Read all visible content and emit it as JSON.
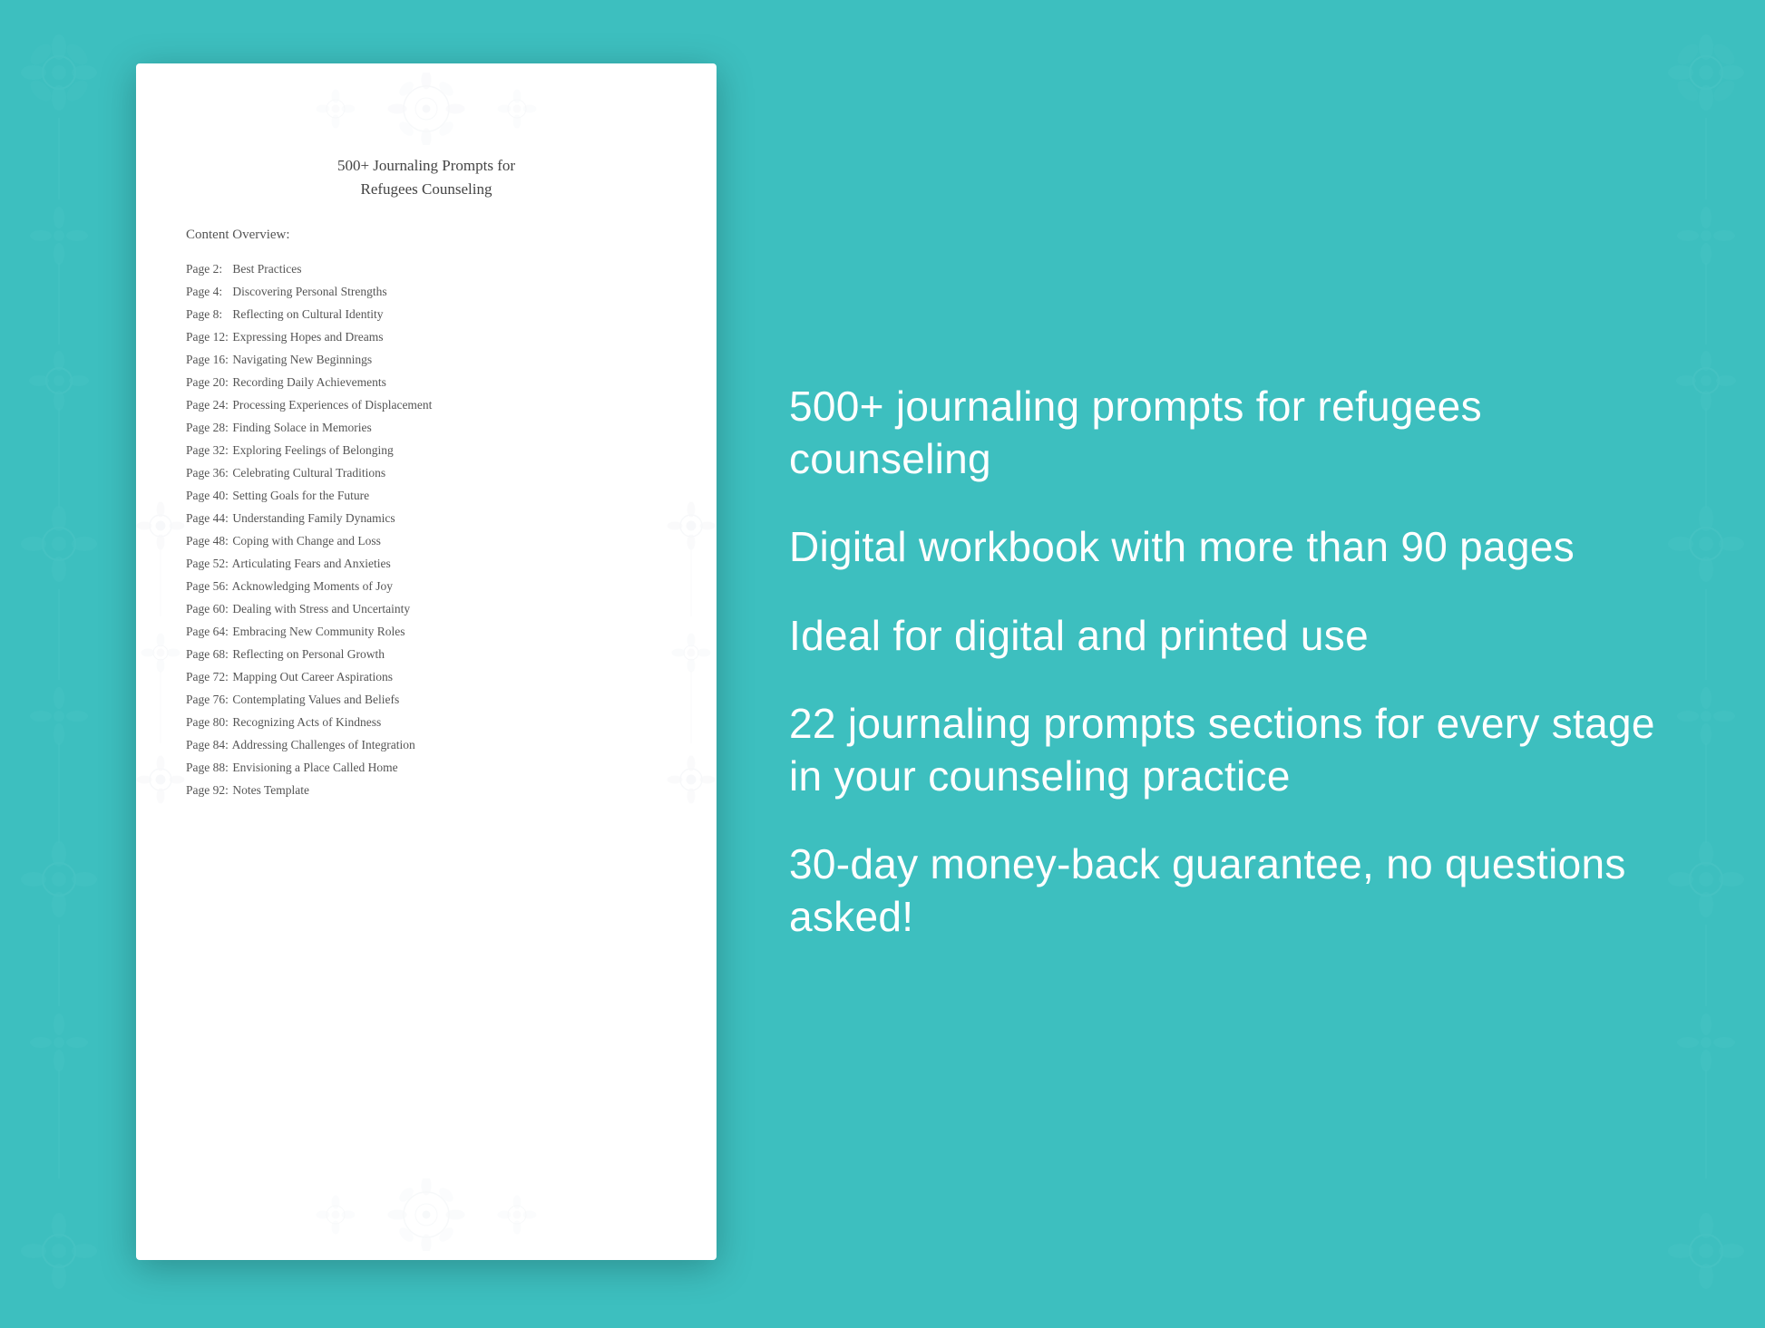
{
  "background_color": "#3dbfbf",
  "document": {
    "title_line1": "500+ Journaling Prompts for",
    "title_line2": "Refugees Counseling",
    "section_label": "Content Overview:",
    "toc_items": [
      {
        "page": "Page  2:",
        "title": "Best Practices"
      },
      {
        "page": "Page  4:",
        "title": "Discovering Personal Strengths"
      },
      {
        "page": "Page  8:",
        "title": "Reflecting on Cultural Identity"
      },
      {
        "page": "Page 12:",
        "title": "Expressing Hopes and Dreams"
      },
      {
        "page": "Page 16:",
        "title": "Navigating New Beginnings"
      },
      {
        "page": "Page 20:",
        "title": "Recording Daily Achievements"
      },
      {
        "page": "Page 24:",
        "title": "Processing Experiences of Displacement"
      },
      {
        "page": "Page 28:",
        "title": "Finding Solace in Memories"
      },
      {
        "page": "Page 32:",
        "title": "Exploring Feelings of Belonging"
      },
      {
        "page": "Page 36:",
        "title": "Celebrating Cultural Traditions"
      },
      {
        "page": "Page 40:",
        "title": "Setting Goals for the Future"
      },
      {
        "page": "Page 44:",
        "title": "Understanding Family Dynamics"
      },
      {
        "page": "Page 48:",
        "title": "Coping with Change and Loss"
      },
      {
        "page": "Page 52:",
        "title": "Articulating Fears and Anxieties"
      },
      {
        "page": "Page 56:",
        "title": "Acknowledging Moments of Joy"
      },
      {
        "page": "Page 60:",
        "title": "Dealing with Stress and Uncertainty"
      },
      {
        "page": "Page 64:",
        "title": "Embracing New Community Roles"
      },
      {
        "page": "Page 68:",
        "title": "Reflecting on Personal Growth"
      },
      {
        "page": "Page 72:",
        "title": "Mapping Out Career Aspirations"
      },
      {
        "page": "Page 76:",
        "title": "Contemplating Values and Beliefs"
      },
      {
        "page": "Page 80:",
        "title": "Recognizing Acts of Kindness"
      },
      {
        "page": "Page 84:",
        "title": "Addressing Challenges of Integration"
      },
      {
        "page": "Page 88:",
        "title": "Envisioning a Place Called Home"
      },
      {
        "page": "Page 92:",
        "title": "Notes Template"
      }
    ]
  },
  "features": [
    "500+ journaling prompts for refugees counseling",
    "Digital workbook with more than 90 pages",
    "Ideal for digital and printed use",
    "22 journaling prompts sections for every stage in your counseling practice",
    "30-day money-back guarantee, no questions asked!"
  ]
}
